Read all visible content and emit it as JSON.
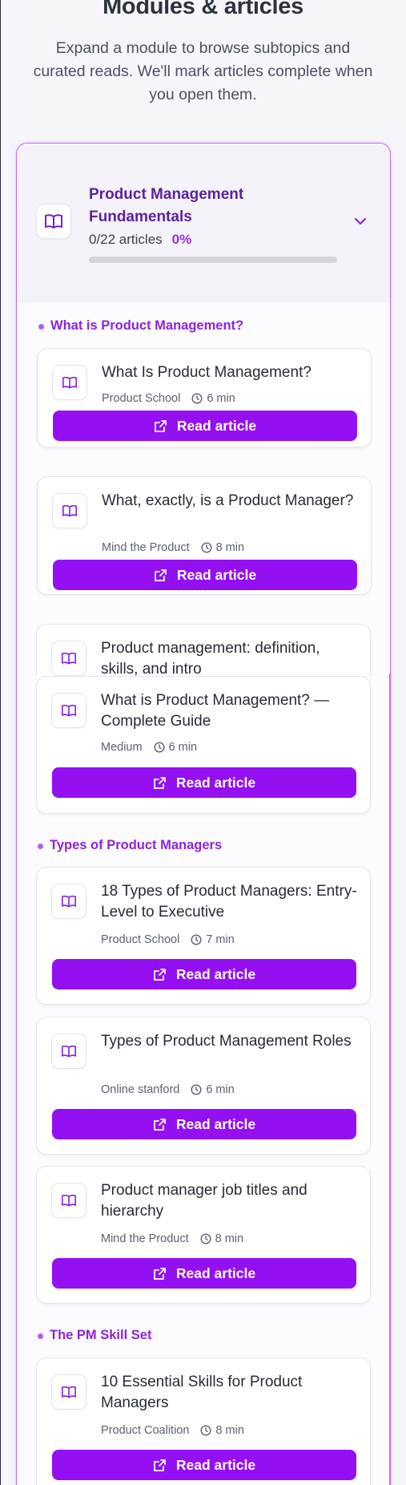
{
  "header": {
    "title": "Modules & articles",
    "subtitle": "Expand a module to browse subtopics and curated reads. We'll mark articles complete when you open them."
  },
  "module": {
    "title": "Product Management Fundamentals",
    "progress_text": "0/22 articles",
    "progress_pct": "0%",
    "progress_value": 0,
    "icon": "book-icon",
    "expand_icon": "chevron-down-icon"
  },
  "colors": {
    "accent": "#9410f2",
    "section": "#8d24d8",
    "module_title": "#5e1f9e"
  },
  "button_label": "Read article",
  "sections": [
    {
      "label": "What is Product Management?",
      "articles": [
        {
          "title": "What Is Product Management?",
          "source": "Product School",
          "duration": "6 min"
        },
        {
          "title": "What, exactly, is a Product Manager?",
          "source": "Mind the Product",
          "duration": "8 min"
        },
        {
          "title": "Product management: definition, skills, and intro"
        },
        {
          "title": "What is Product Management? — Complete Guide",
          "source": "Medium",
          "duration": "6 min"
        }
      ]
    },
    {
      "label": "Types of Product Managers",
      "articles": [
        {
          "title": "18 Types of Product Managers: Entry-Level to Executive",
          "source": "Product School",
          "duration": "7 min"
        },
        {
          "title": "Types of Product Management Roles",
          "source": "Online stanford",
          "duration": "6 min"
        },
        {
          "title": "Product manager job titles and hierarchy",
          "source": "Mind the Product",
          "duration": "8 min"
        }
      ]
    },
    {
      "label": "The PM Skill Set",
      "articles": [
        {
          "title": "10 Essential Skills for Product Managers",
          "source": "Product Coalition",
          "duration": "8 min"
        }
      ]
    }
  ]
}
